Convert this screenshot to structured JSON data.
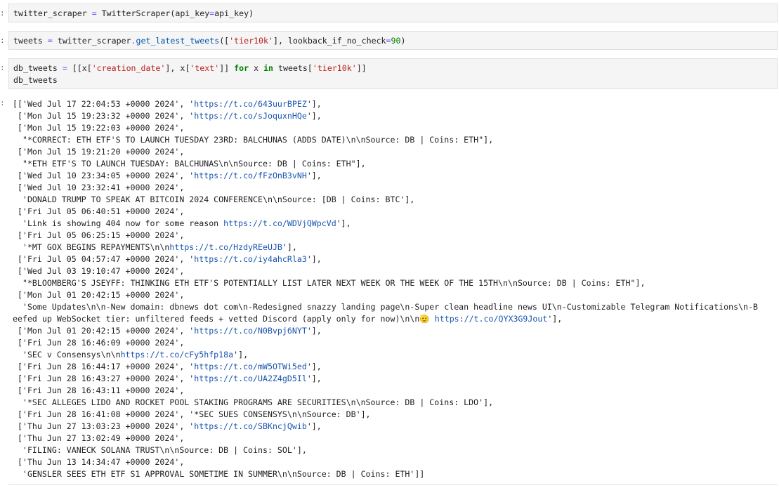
{
  "cells": [
    {
      "prompt": ":",
      "tokens": [
        {
          "t": "twitter_scraper ",
          "c": "tok-var"
        },
        {
          "t": "=",
          "c": "tok-op"
        },
        {
          "t": " TwitterScraper(api_key",
          "c": "tok-var"
        },
        {
          "t": "=",
          "c": "tok-op"
        },
        {
          "t": "api_key)",
          "c": "tok-var"
        }
      ]
    },
    {
      "prompt": ":",
      "tokens": [
        {
          "t": "tweets ",
          "c": "tok-var"
        },
        {
          "t": "=",
          "c": "tok-op"
        },
        {
          "t": " twitter_scraper",
          "c": "tok-var"
        },
        {
          "t": ".",
          "c": "tok-op"
        },
        {
          "t": "get_latest_tweets",
          "c": "tok-fn"
        },
        {
          "t": "([",
          "c": "tok-var"
        },
        {
          "t": "'tier10k'",
          "c": "tok-str"
        },
        {
          "t": "], lookback_if_no_check",
          "c": "tok-var"
        },
        {
          "t": "=",
          "c": "tok-op"
        },
        {
          "t": "90",
          "c": "tok-num"
        },
        {
          "t": ")",
          "c": "tok-var"
        }
      ]
    },
    {
      "prompt": ":",
      "lines": [
        [
          {
            "t": "db_tweets ",
            "c": "tok-var"
          },
          {
            "t": "=",
            "c": "tok-op"
          },
          {
            "t": " [[x[",
            "c": "tok-var"
          },
          {
            "t": "'creation_date'",
            "c": "tok-str"
          },
          {
            "t": "], x[",
            "c": "tok-var"
          },
          {
            "t": "'text'",
            "c": "tok-str"
          },
          {
            "t": "]] ",
            "c": "tok-var"
          },
          {
            "t": "for",
            "c": "tok-kw"
          },
          {
            "t": " x ",
            "c": "tok-var"
          },
          {
            "t": "in",
            "c": "tok-kw"
          },
          {
            "t": " tweets[",
            "c": "tok-var"
          },
          {
            "t": "'tier10k'",
            "c": "tok-str"
          },
          {
            "t": "]]",
            "c": "tok-var"
          }
        ],
        [
          {
            "t": "db_tweets",
            "c": "tok-var"
          }
        ]
      ]
    }
  ],
  "output": {
    "prompt": ":",
    "lines": [
      [
        {
          "t": "[['Wed Jul 17 22:04:53 +0000 2024', '"
        },
        {
          "t": "https://t.co/643uurBPEZ",
          "link": true
        },
        {
          "t": "'],"
        }
      ],
      [
        {
          "t": " ['Mon Jul 15 19:23:32 +0000 2024', '"
        },
        {
          "t": "https://t.co/sJoquxnHQe",
          "link": true
        },
        {
          "t": "'],"
        }
      ],
      [
        {
          "t": " ['Mon Jul 15 19:22:03 +0000 2024',"
        }
      ],
      [
        {
          "t": "  \"*CORRECT: ETH ETF'S TO LAUNCH TUESDAY 23RD: BALCHUNAS (ADDS DATE)\\n\\nSource: DB | Coins: ETH\"],"
        }
      ],
      [
        {
          "t": " ['Mon Jul 15 19:21:20 +0000 2024',"
        }
      ],
      [
        {
          "t": "  \"*ETH ETF'S TO LAUNCH TUESDAY: BALCHUNAS\\n\\nSource: DB | Coins: ETH\"],"
        }
      ],
      [
        {
          "t": " ['Wed Jul 10 23:34:05 +0000 2024', '"
        },
        {
          "t": "https://t.co/fFzOnB3vNH",
          "link": true
        },
        {
          "t": "'],"
        }
      ],
      [
        {
          "t": " ['Wed Jul 10 23:32:41 +0000 2024',"
        }
      ],
      [
        {
          "t": "  'DONALD TRUMP TO SPEAK AT BITCOIN 2024 CONFERENCE\\n\\nSource: [DB | Coins: BTC'],"
        }
      ],
      [
        {
          "t": " ['Fri Jul 05 06:40:51 +0000 2024',"
        }
      ],
      [
        {
          "t": "  'Link is showing 404 now for some reason "
        },
        {
          "t": "https://t.co/WDVjQWpcVd",
          "link": true
        },
        {
          "t": "'],"
        }
      ],
      [
        {
          "t": " ['Fri Jul 05 06:25:15 +0000 2024',"
        }
      ],
      [
        {
          "t": "  '*MT GOX BEGINS REPAYMENTS\\n\\n"
        },
        {
          "t": "https://t.co/HzdyREeUJB",
          "link": true
        },
        {
          "t": "'],"
        }
      ],
      [
        {
          "t": " ['Fri Jul 05 04:57:47 +0000 2024', '"
        },
        {
          "t": "https://t.co/iy4ahcRla3",
          "link": true
        },
        {
          "t": "'],"
        }
      ],
      [
        {
          "t": " ['Wed Jul 03 19:10:47 +0000 2024',"
        }
      ],
      [
        {
          "t": "  \"*BLOOMBERG'S JSEYFF: THINKING ETH ETF'S POTENTIALLY LIST LATER NEXT WEEK OR THE WEEK OF THE 15TH\\n\\nSource: DB | Coins: ETH\"],"
        }
      ],
      [
        {
          "t": " ['Mon Jul 01 20:42:15 +0000 2024',"
        }
      ],
      [
        {
          "t": "  'Some Updates\\n\\n-New domain: dbnews dot com\\n-Redesigned snazzy landing page\\n-Super clean headline news UI\\n-Customizable Telegram Notifications\\n-B"
        }
      ],
      [
        {
          "t": "eefed up WebSocket tier: unfiltered feeds + vetted Discord (apply only for now)\\n\\n🫡 "
        },
        {
          "t": "https://t.co/QYX3G9Jout",
          "link": true
        },
        {
          "t": "'],"
        }
      ],
      [
        {
          "t": " ['Mon Jul 01 20:42:15 +0000 2024', '"
        },
        {
          "t": "https://t.co/N0Bvpj6NYT",
          "link": true
        },
        {
          "t": "'],"
        }
      ],
      [
        {
          "t": " ['Fri Jun 28 16:46:09 +0000 2024',"
        }
      ],
      [
        {
          "t": "  'SEC v Consensys\\n\\n"
        },
        {
          "t": "https://t.co/cFy5hfp18a",
          "link": true
        },
        {
          "t": "'],"
        }
      ],
      [
        {
          "t": " ['Fri Jun 28 16:44:17 +0000 2024', '"
        },
        {
          "t": "https://t.co/mW5OTWi5ed",
          "link": true
        },
        {
          "t": "'],"
        }
      ],
      [
        {
          "t": " ['Fri Jun 28 16:43:27 +0000 2024', '"
        },
        {
          "t": "https://t.co/UA2Z4gD5Il",
          "link": true
        },
        {
          "t": "'],"
        }
      ],
      [
        {
          "t": " ['Fri Jun 28 16:43:11 +0000 2024',"
        }
      ],
      [
        {
          "t": "  '*SEC ALLEGES LIDO AND ROCKET POOL STAKING PROGRAMS ARE SECURITIES\\n\\nSource: DB | Coins: LDO'],"
        }
      ],
      [
        {
          "t": " ['Fri Jun 28 16:41:08 +0000 2024', '*SEC SUES CONSENSYS\\n\\nSource: DB'],"
        }
      ],
      [
        {
          "t": " ['Thu Jun 27 13:03:23 +0000 2024', '"
        },
        {
          "t": "https://t.co/SBKncjQwib",
          "link": true
        },
        {
          "t": "'],"
        }
      ],
      [
        {
          "t": " ['Thu Jun 27 13:02:49 +0000 2024',"
        }
      ],
      [
        {
          "t": "  'FILING: VANECK SOLANA TRUST\\n\\nSource: DB | Coins: SOL'],"
        }
      ],
      [
        {
          "t": " ['Thu Jun 13 14:34:47 +0000 2024',"
        }
      ],
      [
        {
          "t": "  'GENSLER SEES ETH ETF S1 APPROVAL SOMETIME IN SUMMER\\n\\nSource: DB | Coins: ETH']]"
        }
      ]
    ]
  }
}
